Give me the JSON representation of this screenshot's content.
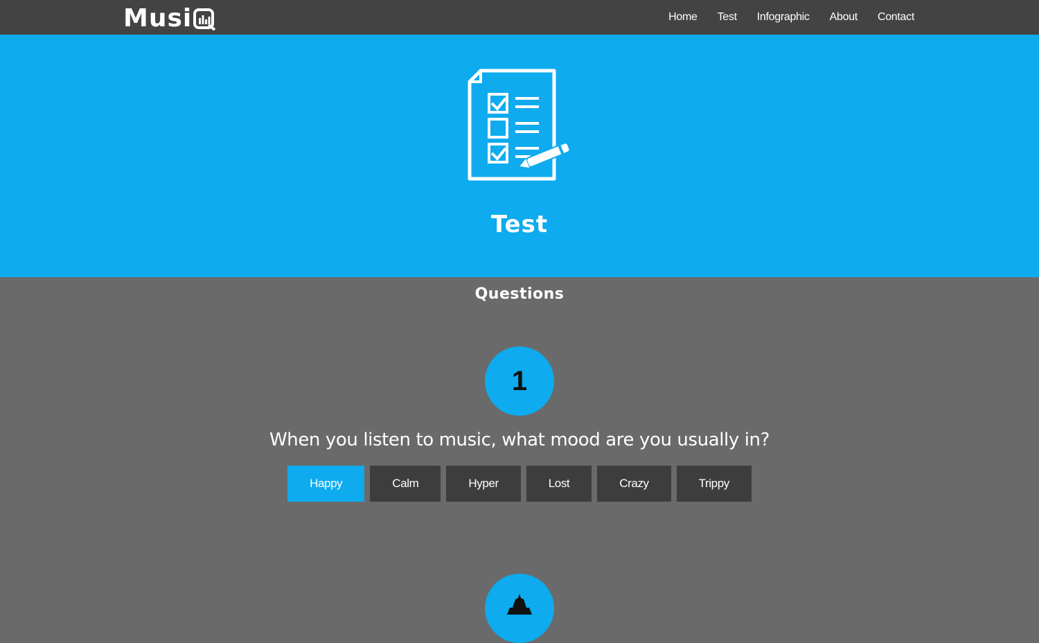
{
  "brand": {
    "logo_text": "Musi",
    "logo_letter": "Q"
  },
  "nav": {
    "items": [
      {
        "label": "Home"
      },
      {
        "label": "Test"
      },
      {
        "label": "Infographic"
      },
      {
        "label": "About"
      },
      {
        "label": "Contact"
      }
    ]
  },
  "hero": {
    "icon": "checklist-clipboard-icon",
    "title": "Test"
  },
  "questions": {
    "heading": "Questions",
    "items": [
      {
        "number": "1",
        "text": "When you listen to music, what mood are you usually in?",
        "options": [
          {
            "label": "Happy",
            "selected": true
          },
          {
            "label": "Calm",
            "selected": false
          },
          {
            "label": "Hyper",
            "selected": false
          },
          {
            "label": "Lost",
            "selected": false
          },
          {
            "label": "Crazy",
            "selected": false
          },
          {
            "label": "Trippy",
            "selected": false
          }
        ]
      },
      {
        "icon": "question-two-icon"
      }
    ]
  },
  "colors": {
    "accent": "#0eabee",
    "navbar": "#434343",
    "background": "#6a6a6a",
    "button": "#3d3d3d"
  }
}
